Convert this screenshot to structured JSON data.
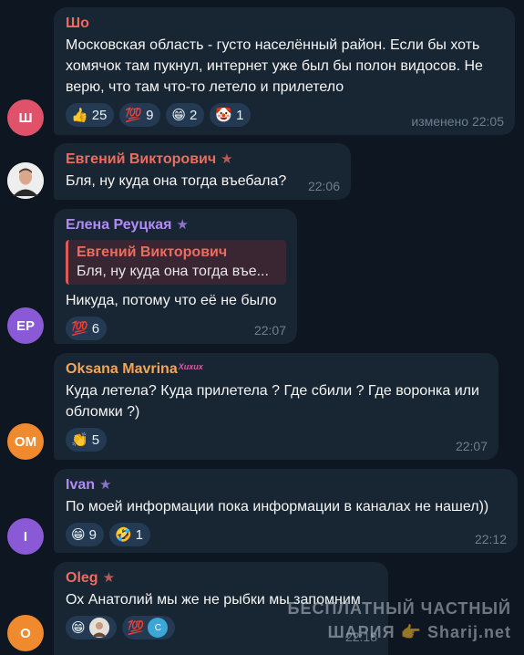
{
  "messages": [
    {
      "sender": "Шо",
      "avatar_initials": "Ш",
      "avatar_color": "#e0526a",
      "name_color": "#ec6d5e",
      "text": "Московская область - густо населённый район. Если бы хоть хомячок там пукнул, интернет уже был бы полон видосов. Не верю, что там что-то летело и прилетело",
      "reactions": [
        {
          "emoji": "👍",
          "count": "25"
        },
        {
          "emoji": "💯",
          "count": "9"
        },
        {
          "emoji": "😁",
          "count": "2"
        },
        {
          "emoji": "🤡",
          "count": "1"
        }
      ],
      "time": "изменено 22:05"
    },
    {
      "sender": "Евгений Викторович",
      "avatar_icon": "person-photo",
      "name_color": "#ec6d5e",
      "text": "Бля, ну куда она тогда въебала?",
      "time": "22:06"
    },
    {
      "sender": "Елена Реуцкая",
      "avatar_initials": "ЕР",
      "avatar_color": "#8a5ad6",
      "name_color": "#b18cf5",
      "reply_name": "Евгений Викторович",
      "reply_text": "Бля, ну куда она тогда въе...",
      "text": "Никуда, потому что её не было",
      "reactions": [
        {
          "emoji": "💯",
          "count": "6"
        }
      ],
      "time": "22:07"
    },
    {
      "sender": "Oksana Mavrina",
      "sender_badge": "Хихих",
      "avatar_initials": "OM",
      "avatar_color": "#f08a2e",
      "name_color": "#f2a65a",
      "text": "Куда летела? Куда прилетела ? Где сбили ? Где воронка или обломки ?)",
      "reactions": [
        {
          "emoji": "👏",
          "count": "5"
        }
      ],
      "time": "22:07"
    },
    {
      "sender": "Ivan",
      "avatar_initials": "I",
      "avatar_color": "#8a5ad6",
      "name_color": "#b18cf5",
      "text": "По моей информации пока информации в каналах не нашел))",
      "reactions": [
        {
          "emoji": "😁",
          "count": "9"
        },
        {
          "emoji": "🤣",
          "count": "1"
        }
      ],
      "time": "22:12"
    },
    {
      "sender": "Oleg",
      "avatar_initials": "O",
      "avatar_color": "#f08a2e",
      "name_color": "#ec6d5e",
      "text": "Ох Анатолий мы же не рыбки мы запомним",
      "reactions_mini": [
        {
          "emoji": "😁",
          "avatar": "photo"
        },
        {
          "emoji": "💯",
          "avatar": "C"
        }
      ],
      "time": "22:18"
    }
  ],
  "watermark": {
    "line1": "БЕСПЛАТНЫЙ ЧАСТНЫЙ",
    "line2": "ШАРИЯ 👉 Sharij.net"
  }
}
